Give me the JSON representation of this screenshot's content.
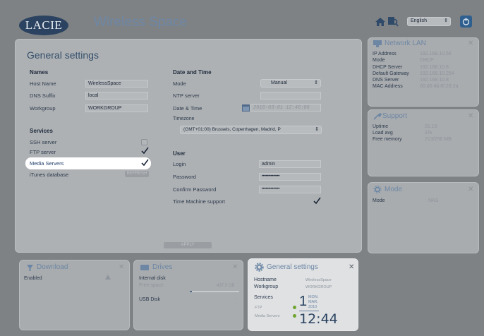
{
  "header": {
    "logo_text": "LACIE",
    "app_name": "Wireless Space",
    "language": "English"
  },
  "page_title": "General settings",
  "names": {
    "title": "Names",
    "host_name_label": "Host Name",
    "host_name_value": "WirelessSpace",
    "dns_suffix_label": "DNS Suffix",
    "dns_suffix_value": "local",
    "workgroup_label": "Workgroup",
    "workgroup_value": "WORKGROUP"
  },
  "datetime": {
    "title": "Date and Time",
    "mode_label": "Mode",
    "mode_value": "Manual",
    "ntp_label": "NTP server",
    "date_label": "Date & Time",
    "date_value": "2010-03-01 12:46:06",
    "timezone_label": "Timezone",
    "timezone_value": "(GMT+01:00) Brussels, Copenhagen, Madrid, P"
  },
  "services": {
    "title": "Services",
    "ssh_label": "SSH server",
    "ftp_label": "FTP server",
    "media_label": "Media Servers",
    "itunes_label": "iTunes database",
    "refresh_label": "REFRESH"
  },
  "user": {
    "title": "User",
    "login_label": "Login",
    "login_value": "admin",
    "password_label": "Password",
    "password_value": "••••••••••••••",
    "confirm_label": "Confirm Password",
    "confirm_value": "••••••••••••••",
    "timemachine_label": "Time Machine support"
  },
  "apply_label": "APPLY",
  "network": {
    "title": "Network LAN",
    "rows": [
      {
        "label": "IP Address",
        "value": "192.168.10.56"
      },
      {
        "label": "Mode",
        "value": "DHCP"
      },
      {
        "label": "DHCP Server",
        "value": "192.168.10.8"
      },
      {
        "label": "Default Gateway",
        "value": "192.168.10.254"
      },
      {
        "label": "DNS Server",
        "value": "192.168.10.8"
      },
      {
        "label": "MAC Address",
        "value": "00:d0:4b:8f:29:2a"
      }
    ]
  },
  "support": {
    "title": "Support",
    "rows": [
      {
        "label": "Uptime",
        "value": "01:15"
      },
      {
        "label": "Load avg",
        "value": "1%"
      },
      {
        "label": "Free memory",
        "value": "213/256 MB"
      }
    ]
  },
  "mode_widget": {
    "title": "Mode",
    "label": "Mode",
    "value": "NAS"
  },
  "download": {
    "title": "Download",
    "status": "Enabled"
  },
  "drives": {
    "title": "Drives",
    "internal_label": "Internal disk",
    "free_label": "Free space",
    "free_value": "437.5 GB",
    "usb_label": "USB Disk",
    "usb_value": "-"
  },
  "general_widget": {
    "title": "General settings",
    "hostname_label": "Hostname",
    "hostname_value": "WirelessSpace",
    "workgroup_label": "Workgroup",
    "workgroup_value": "WORKGROUP",
    "services_label": "Services",
    "ftp_label": "FTP",
    "media_label": "Media Servers",
    "day_number": "1",
    "weekday": "MON.",
    "month": "MAR.",
    "year": "2010",
    "time": "12:44"
  },
  "colors": {
    "highlight": "#ffffff",
    "accent": "#6d87a6",
    "status_green": "#6ea52f"
  }
}
